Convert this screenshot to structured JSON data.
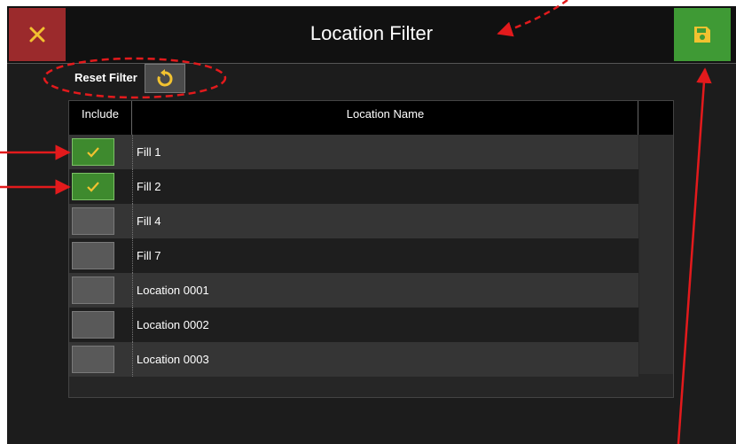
{
  "header": {
    "title": "Location Filter",
    "close_icon": "close-x-icon",
    "save_icon": "floppy-save-icon"
  },
  "toolbar": {
    "reset_label": "Reset Filter",
    "reset_icon": "rotate-reset-icon"
  },
  "table": {
    "columns": [
      "Include",
      "Location Name"
    ],
    "rows": [
      {
        "name": "Fill 1",
        "included": true
      },
      {
        "name": "Fill 2",
        "included": true
      },
      {
        "name": "Fill 4",
        "included": false
      },
      {
        "name": "Fill 7",
        "included": false
      },
      {
        "name": "Location 0001",
        "included": false
      },
      {
        "name": "Location 0002",
        "included": false
      },
      {
        "name": "Location 0003",
        "included": false
      }
    ]
  },
  "colors": {
    "close_button": "#9b2a2c",
    "save_button": "#3f9a35",
    "checked": "#3e8a2e",
    "unchecked": "#595959",
    "annotation": "#e31a1c"
  }
}
